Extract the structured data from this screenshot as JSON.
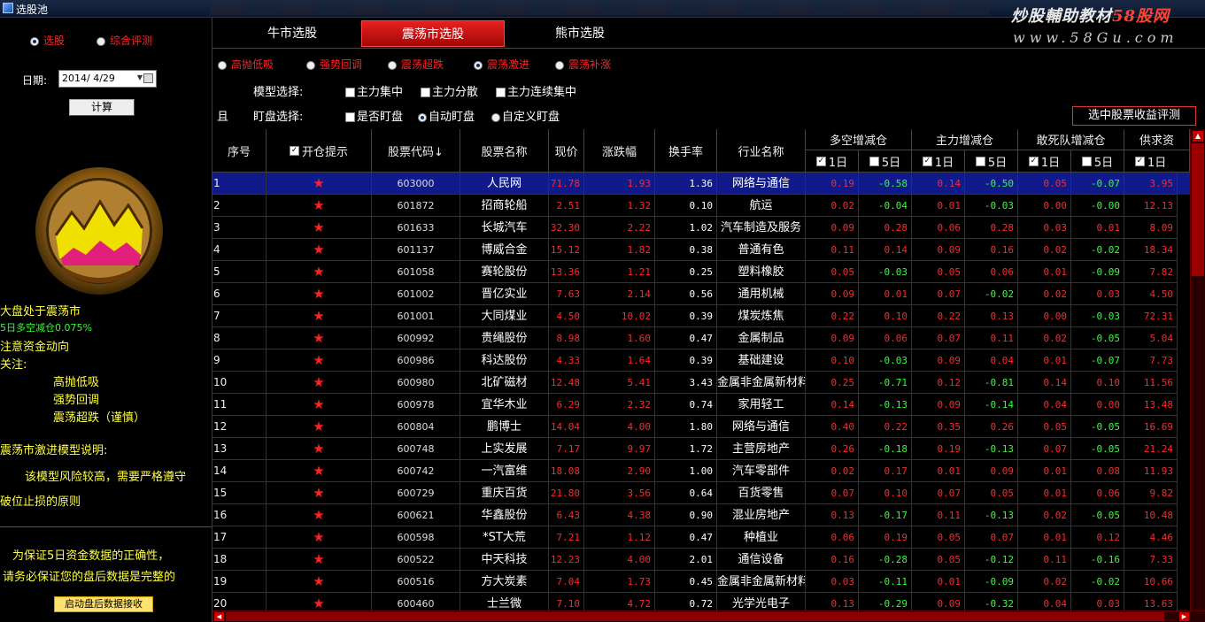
{
  "window": {
    "title": "选股池"
  },
  "watermark": {
    "line1_a": "炒股輔助教材",
    "line1_b": "58股网",
    "line2": "www.58Gu.com"
  },
  "left": {
    "radio1": "选股",
    "radio2": "综合评测",
    "date_label": "日期:",
    "date_value": "2014/ 4/29",
    "compute_button": "计算",
    "market_status": "大盘处于震荡市",
    "fund_flow": "5日多空减仓0.075%",
    "notice_flow": "注意资金动向",
    "focus_label": "关注:",
    "focus_items": [
      "高抛低吸",
      "强势回调",
      "震荡超跌（谨慎）"
    ],
    "model_title": "震荡市激进模型说明:",
    "model_desc_1": "该模型风险较高，需要严格遵守",
    "model_desc_2": "破位止损的原则",
    "note_1": "为保证5日资金数据的正确性，",
    "note_2": "请务必保证您的盘后数据是完整的",
    "data_button": "启动盘后数据接收"
  },
  "tabs": {
    "bull": "牛市选股",
    "oscillating": "震荡市选股",
    "bear": "熊市选股"
  },
  "sub_modes": [
    "高抛低吸",
    "强势回调",
    "震荡超跌",
    "震荡激进",
    "震荡补涨"
  ],
  "sub_mode_selected": 3,
  "options": {
    "model_label": "模型选择:",
    "model_opts": [
      "主力集中",
      "主力分散",
      "主力连续集中"
    ],
    "and_label": "且",
    "watch_label": "盯盘选择:",
    "watch_opts": [
      "是否盯盘",
      "自动盯盘",
      "自定义盯盘"
    ],
    "eval_button": "选中股票收益评测"
  },
  "table": {
    "headers": {
      "seq": "序号",
      "open_hint": "开仓提示",
      "code": "股票代码↓",
      "name": "股票名称",
      "price": "现价",
      "change": "涨跌幅",
      "turnover": "换手率",
      "industry": "行业名称",
      "g1": "多空增减仓",
      "g2": "主力增减仓",
      "g3": "敢死队增减仓",
      "g4": "供求资",
      "d1": "1日",
      "d5": "5日"
    },
    "star": "★",
    "rows": [
      {
        "seq": "1",
        "code": "603000",
        "name": "人民网",
        "price": "71.78",
        "chg": "1.93",
        "turn": "1.36",
        "ind": "网络与通信",
        "v1": "0.19",
        "v2": "-0.58",
        "v3": "0.14",
        "v4": "-0.50",
        "v5": "0.05",
        "v6": "-0.07",
        "v7": "3.95"
      },
      {
        "seq": "2",
        "code": "601872",
        "name": "招商轮船",
        "price": "2.51",
        "chg": "1.32",
        "turn": "0.10",
        "ind": "航运",
        "v1": "0.02",
        "v2": "-0.04",
        "v3": "0.01",
        "v4": "-0.03",
        "v5": "0.00",
        "v6": "-0.00",
        "v7": "12.13"
      },
      {
        "seq": "3",
        "code": "601633",
        "name": "长城汽车",
        "price": "32.30",
        "chg": "2.22",
        "turn": "1.02",
        "ind": "汽车制造及服务",
        "v1": "0.09",
        "v2": "0.28",
        "v3": "0.06",
        "v4": "0.28",
        "v5": "0.03",
        "v6": "0.01",
        "v7": "8.09"
      },
      {
        "seq": "4",
        "code": "601137",
        "name": "博威合金",
        "price": "15.12",
        "chg": "1.82",
        "turn": "0.38",
        "ind": "普通有色",
        "v1": "0.11",
        "v2": "0.14",
        "v3": "0.09",
        "v4": "0.16",
        "v5": "0.02",
        "v6": "-0.02",
        "v7": "18.34"
      },
      {
        "seq": "5",
        "code": "601058",
        "name": "赛轮股份",
        "price": "13.36",
        "chg": "1.21",
        "turn": "0.25",
        "ind": "塑料橡胶",
        "v1": "0.05",
        "v2": "-0.03",
        "v3": "0.05",
        "v4": "0.06",
        "v5": "0.01",
        "v6": "-0.09",
        "v7": "7.82"
      },
      {
        "seq": "6",
        "code": "601002",
        "name": "晋亿实业",
        "price": "7.63",
        "chg": "2.14",
        "turn": "0.56",
        "ind": "通用机械",
        "v1": "0.09",
        "v2": "0.01",
        "v3": "0.07",
        "v4": "-0.02",
        "v5": "0.02",
        "v6": "0.03",
        "v7": "4.50"
      },
      {
        "seq": "7",
        "code": "601001",
        "name": "大同煤业",
        "price": "4.50",
        "chg": "10.02",
        "turn": "0.39",
        "ind": "煤炭炼焦",
        "v1": "0.22",
        "v2": "0.10",
        "v3": "0.22",
        "v4": "0.13",
        "v5": "0.00",
        "v6": "-0.03",
        "v7": "72.31"
      },
      {
        "seq": "8",
        "code": "600992",
        "name": "贵绳股份",
        "price": "8.98",
        "chg": "1.60",
        "turn": "0.47",
        "ind": "金属制品",
        "v1": "0.09",
        "v2": "0.06",
        "v3": "0.07",
        "v4": "0.11",
        "v5": "0.02",
        "v6": "-0.05",
        "v7": "5.04"
      },
      {
        "seq": "9",
        "code": "600986",
        "name": "科达股份",
        "price": "4.33",
        "chg": "1.64",
        "turn": "0.39",
        "ind": "基础建设",
        "v1": "0.10",
        "v2": "-0.03",
        "v3": "0.09",
        "v4": "0.04",
        "v5": "0.01",
        "v6": "-0.07",
        "v7": "7.73"
      },
      {
        "seq": "10",
        "code": "600980",
        "name": "北矿磁材",
        "price": "12.48",
        "chg": "5.41",
        "turn": "3.43",
        "ind": "金属非金属新材料",
        "v1": "0.25",
        "v2": "-0.71",
        "v3": "0.12",
        "v4": "-0.81",
        "v5": "0.14",
        "v6": "0.10",
        "v7": "11.56"
      },
      {
        "seq": "11",
        "code": "600978",
        "name": "宜华木业",
        "price": "6.29",
        "chg": "2.32",
        "turn": "0.74",
        "ind": "家用轻工",
        "v1": "0.14",
        "v2": "-0.13",
        "v3": "0.09",
        "v4": "-0.14",
        "v5": "0.04",
        "v6": "0.00",
        "v7": "13.48"
      },
      {
        "seq": "12",
        "code": "600804",
        "name": "鹏博士",
        "price": "14.04",
        "chg": "4.00",
        "turn": "1.80",
        "ind": "网络与通信",
        "v1": "0.40",
        "v2": "0.22",
        "v3": "0.35",
        "v4": "0.26",
        "v5": "0.05",
        "v6": "-0.05",
        "v7": "16.69"
      },
      {
        "seq": "13",
        "code": "600748",
        "name": "上实发展",
        "price": "7.17",
        "chg": "9.97",
        "turn": "1.72",
        "ind": "主营房地产",
        "v1": "0.26",
        "v2": "-0.18",
        "v3": "0.19",
        "v4": "-0.13",
        "v5": "0.07",
        "v6": "-0.05",
        "v7": "21.24"
      },
      {
        "seq": "14",
        "code": "600742",
        "name": "一汽富维",
        "price": "18.08",
        "chg": "2.90",
        "turn": "1.00",
        "ind": "汽车零部件",
        "v1": "0.02",
        "v2": "0.17",
        "v3": "0.01",
        "v4": "0.09",
        "v5": "0.01",
        "v6": "0.08",
        "v7": "11.93"
      },
      {
        "seq": "15",
        "code": "600729",
        "name": "重庆百货",
        "price": "21.80",
        "chg": "3.56",
        "turn": "0.64",
        "ind": "百货零售",
        "v1": "0.07",
        "v2": "0.10",
        "v3": "0.07",
        "v4": "0.05",
        "v5": "0.01",
        "v6": "0.06",
        "v7": "9.82"
      },
      {
        "seq": "16",
        "code": "600621",
        "name": "华鑫股份",
        "price": "6.43",
        "chg": "4.38",
        "turn": "0.90",
        "ind": "混业房地产",
        "v1": "0.13",
        "v2": "-0.17",
        "v3": "0.11",
        "v4": "-0.13",
        "v5": "0.02",
        "v6": "-0.05",
        "v7": "10.48"
      },
      {
        "seq": "17",
        "code": "600598",
        "name": "*ST大荒",
        "price": "7.21",
        "chg": "1.12",
        "turn": "0.47",
        "ind": "种植业",
        "v1": "0.06",
        "v2": "0.19",
        "v3": "0.05",
        "v4": "0.07",
        "v5": "0.01",
        "v6": "0.12",
        "v7": "4.46"
      },
      {
        "seq": "18",
        "code": "600522",
        "name": "中天科技",
        "price": "12.23",
        "chg": "4.00",
        "turn": "2.01",
        "ind": "通信设备",
        "v1": "0.16",
        "v2": "-0.28",
        "v3": "0.05",
        "v4": "-0.12",
        "v5": "0.11",
        "v6": "-0.16",
        "v7": "7.33"
      },
      {
        "seq": "19",
        "code": "600516",
        "name": "方大炭素",
        "price": "7.04",
        "chg": "1.73",
        "turn": "0.45",
        "ind": "金属非金属新材料",
        "v1": "0.03",
        "v2": "-0.11",
        "v3": "0.01",
        "v4": "-0.09",
        "v5": "0.02",
        "v6": "-0.02",
        "v7": "10.66"
      },
      {
        "seq": "20",
        "code": "600460",
        "name": "士兰微",
        "price": "7.10",
        "chg": "4.72",
        "turn": "0.72",
        "ind": "光学光电子",
        "v1": "0.13",
        "v2": "-0.29",
        "v3": "0.09",
        "v4": "-0.32",
        "v5": "0.04",
        "v6": "0.03",
        "v7": "13.63"
      }
    ]
  },
  "colors": {
    "positive": "#ff2828",
    "negative": "#33ff33",
    "selected_row": "#101a8a",
    "active_tab": "#d01010"
  }
}
